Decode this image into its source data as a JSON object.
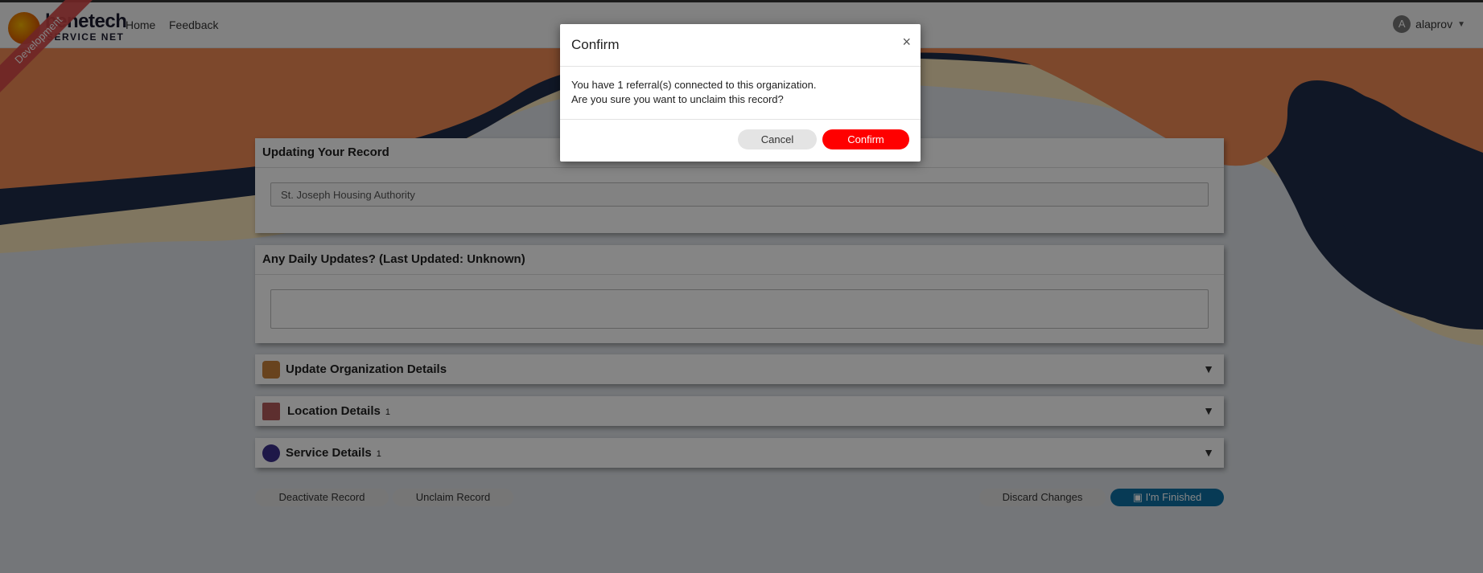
{
  "brand": {
    "name": "benetech",
    "sub": "SERVICE NET",
    "ribbon": "Development"
  },
  "nav": {
    "home": "Home",
    "feedback": "Feedback"
  },
  "user": {
    "initial": "A",
    "name": "alaprov"
  },
  "record_panel": {
    "title": "Updating Your Record",
    "org_name": "St. Joseph Housing Authority"
  },
  "daily_panel": {
    "title": "Any Daily Updates? (Last Updated: Unknown)",
    "value": ""
  },
  "accordions": [
    {
      "title": "Update Organization Details",
      "count": ""
    },
    {
      "title": "Location Details",
      "count": "1"
    },
    {
      "title": "Service Details",
      "count": "1"
    }
  ],
  "actions": {
    "deactivate": "Deactivate Record",
    "unclaim": "Unclaim Record",
    "discard": "Discard Changes",
    "finished": "I'm Finished"
  },
  "modal": {
    "title": "Confirm",
    "close": "×",
    "line1": "You have 1 referral(s) connected to this organization.",
    "line2": "Are you sure you want to unclaim this record?",
    "cancel": "Cancel",
    "confirm": "Confirm"
  },
  "colors": {
    "accent_blue": "#0e6fa3",
    "confirm_red": "#ff0000",
    "shape_orange": "#f08a55",
    "shape_navy": "#1f2d4a",
    "shape_cream": "#f6e2b8"
  }
}
